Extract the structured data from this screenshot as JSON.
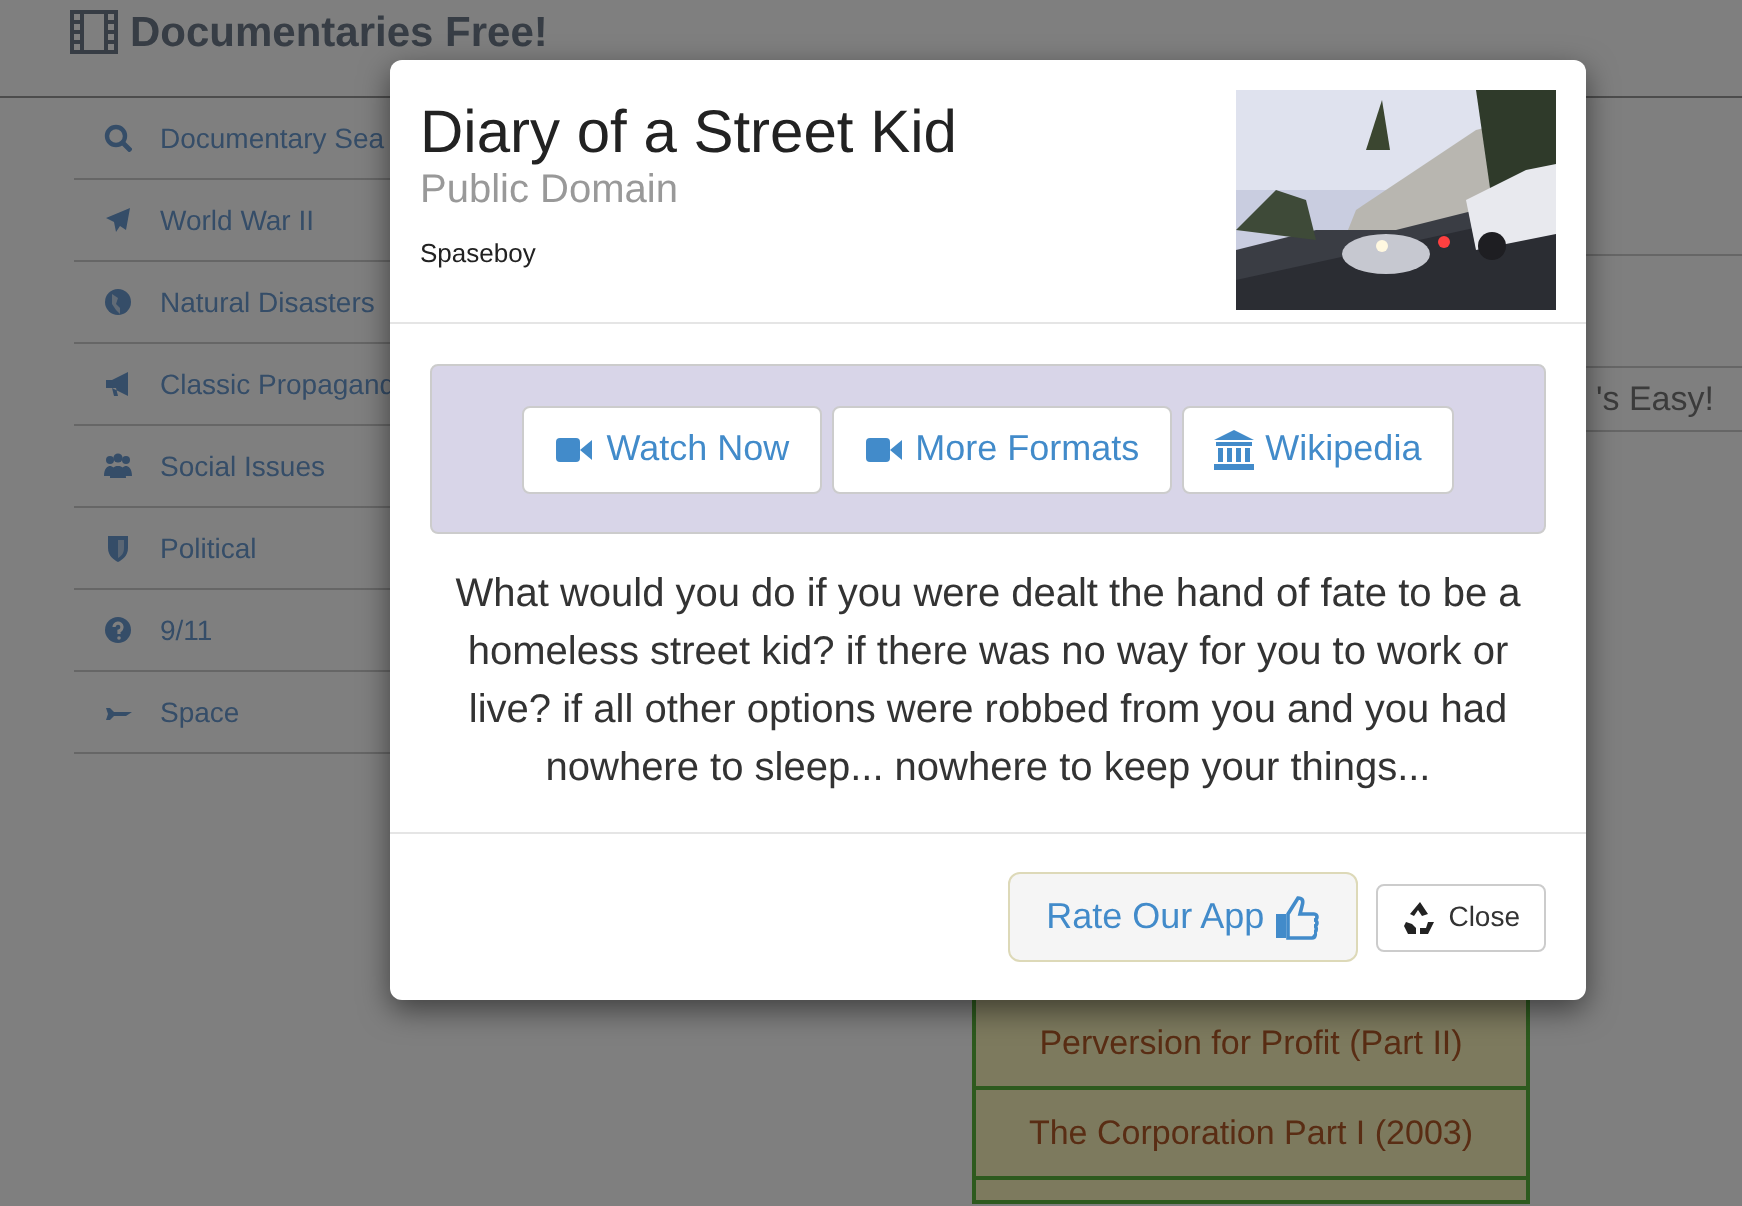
{
  "app": {
    "title": "Documentaries Free!"
  },
  "sidebar": {
    "items": [
      {
        "label": "Documentary Sea"
      },
      {
        "label": "World War II"
      },
      {
        "label": "Natural Disasters"
      },
      {
        "label": "Classic Propagand"
      },
      {
        "label": "Social Issues"
      },
      {
        "label": "Political"
      },
      {
        "label": "9/11"
      },
      {
        "label": "Space"
      }
    ]
  },
  "banner": {
    "text": "'s Easy!"
  },
  "list": {
    "items": [
      "Perversion for Profit (Part II)",
      "The Corporation Part I (2003)"
    ]
  },
  "modal": {
    "title": "Diary of a Street Kid",
    "subtitle": "Public Domain",
    "author": "Spaseboy",
    "buttons": [
      {
        "label": "Watch Now",
        "kind": "video"
      },
      {
        "label": "More Formats",
        "kind": "video"
      },
      {
        "label": "Wikipedia",
        "kind": "bank"
      }
    ],
    "description": "What would you do if you were dealt the hand of fate to be a homeless street kid? if there was no way for you to work or live? if all other options were robbed from you and you had nowhere to sleep... nowhere to keep your things...",
    "footer_buttons": [
      {
        "label": "Rate Our App",
        "kind": "rate"
      },
      {
        "label": "Close",
        "kind": "close"
      }
    ]
  }
}
